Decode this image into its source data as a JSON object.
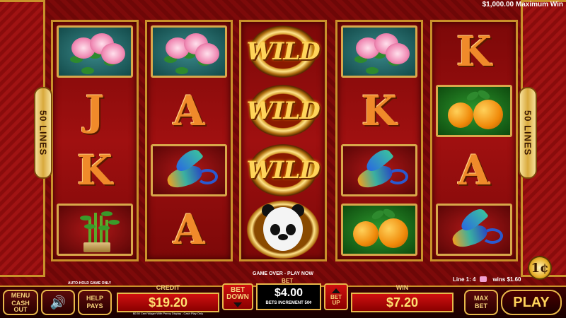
{
  "header": {
    "max_win": "$1,000.00 Maximum Win"
  },
  "side_badges": {
    "left_label": "50 LINES",
    "right_label": "50 LINES"
  },
  "reels": [
    [
      "peony",
      "J",
      "K",
      "bamboo"
    ],
    [
      "peony",
      "A",
      "phoenix",
      "A"
    ],
    [
      "wild",
      "wild",
      "wild",
      "panda"
    ],
    [
      "peony",
      "K",
      "phoenix",
      "oranges"
    ],
    [
      "K",
      "oranges",
      "A",
      "phoenix"
    ]
  ],
  "symbols": {
    "wild_text": "WILD"
  },
  "denomination": "1¢",
  "status": {
    "game_status": "GAME OVER - PLAY NOW",
    "auto_hold": "AUTO-HOLD GAME ONLY",
    "line_prefix": "Line 1: 4",
    "line_wins": "wins $1.60"
  },
  "controls": {
    "menu_top": "MENU",
    "menu_bottom": "CASH OUT",
    "sound_icon": "speaker-icon",
    "help_top": "HELP",
    "help_bottom": "PAYS",
    "max_top": "MAX",
    "max_bottom": "BET",
    "play": "PLAY"
  },
  "meters": {
    "credit_label": "CREDIT",
    "credit_value": "$19.20",
    "promo": "$0.50 Cent Wager With Penny Display - Cash Play Only",
    "bet_label": "BET",
    "bet_value": "$4.00",
    "bet_increment": "BETS INCREMENT 50¢",
    "bet_down_top": "BET",
    "bet_down_bottom": "DOWN",
    "bet_up_top": "BET",
    "bet_up_bottom": "UP",
    "win_label": "WIN",
    "win_value": "$7.20"
  },
  "colors": {
    "gold": "#e8b84a",
    "meter_red": "#d01010",
    "letter_orange": "#f08a2a"
  }
}
